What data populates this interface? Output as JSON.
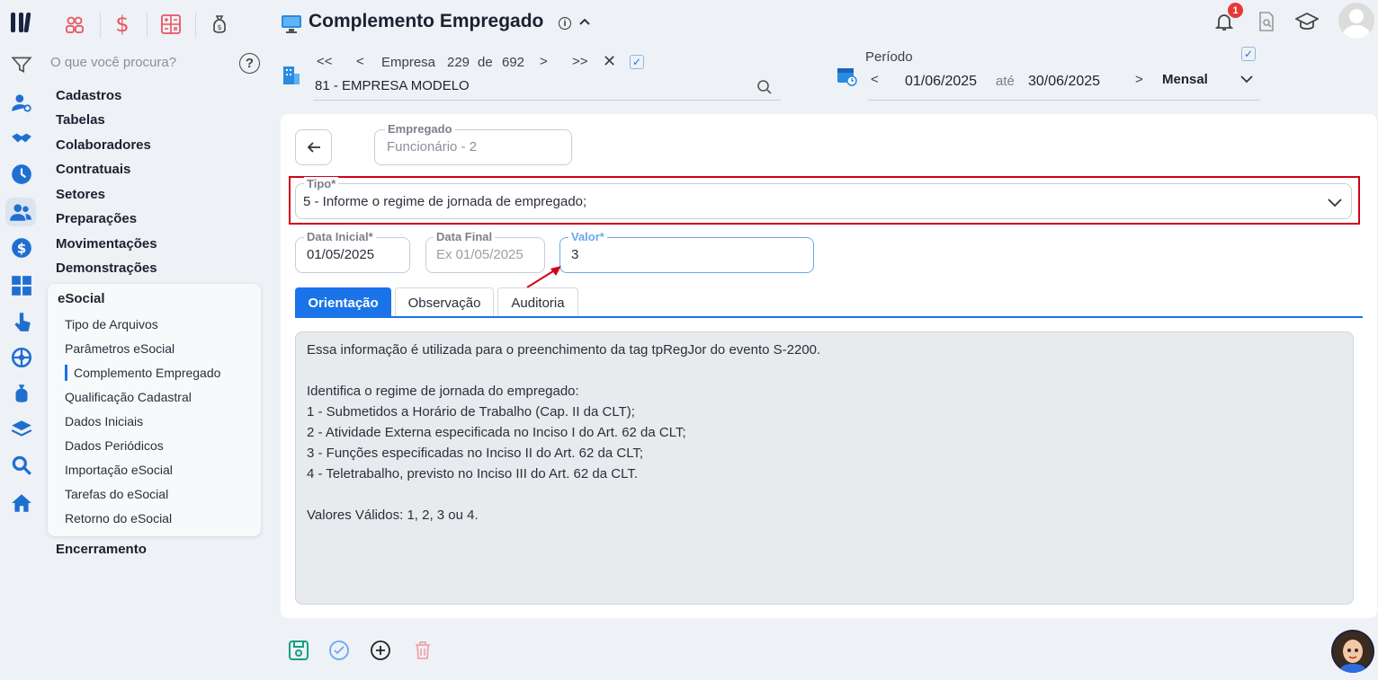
{
  "app": {
    "logo": "M-logo"
  },
  "modules": [
    {
      "icon": "people-icon"
    },
    {
      "icon": "dollar-icon"
    },
    {
      "icon": "calculator-icon"
    },
    {
      "icon": "money-bag-icon"
    }
  ],
  "search": {
    "placeholder": "O que você procura?"
  },
  "menu": {
    "items": [
      "Cadastros",
      "Tabelas",
      "Colaboradores",
      "Contratuais",
      "Setores",
      "Preparações",
      "Movimentações",
      "Demonstrações"
    ],
    "esocial": {
      "title": "eSocial",
      "items": [
        "Tipo de Arquivos",
        "Parâmetros eSocial",
        "Complemento Empregado",
        "Qualificação Cadastral",
        "Dados Iniciais",
        "Dados Periódicos",
        "Importação eSocial",
        "Tarefas do eSocial",
        "Retorno do eSocial"
      ],
      "active": "Complemento Empregado"
    },
    "last": "Encerramento"
  },
  "header": {
    "title": "Complemento Empregado",
    "notifications": "1"
  },
  "company_nav": {
    "first": "<<",
    "prev": "<",
    "label": "Empresa",
    "current": "229",
    "of": "de",
    "total": "692",
    "next": ">",
    "last": ">>",
    "selected": "81 - EMPRESA MODELO"
  },
  "period": {
    "label": "Período",
    "start": "01/06/2025",
    "until": "até",
    "end": "30/06/2025",
    "mode": "Mensal"
  },
  "form": {
    "employee": {
      "label": "Empregado",
      "value": "Funcionário - 2"
    },
    "tipo": {
      "label": "Tipo*",
      "value": "5 - Informe o regime de jornada de empregado;"
    },
    "data_inicial": {
      "label": "Data Inicial*",
      "value": "01/05/2025"
    },
    "data_final": {
      "label": "Data Final",
      "placeholder": "Ex 01/05/2025"
    },
    "valor": {
      "label": "Valor*",
      "value": "3"
    }
  },
  "tabs": [
    {
      "label": "Orientação",
      "active": true
    },
    {
      "label": "Observação",
      "active": false
    },
    {
      "label": "Auditoria",
      "active": false
    }
  ],
  "orientation": [
    "Essa informação é utilizada para o preenchimento da tag tpRegJor do evento S-2200.",
    "",
    "Identifica o regime de jornada do empregado:",
    "1 - Submetidos a Horário de Trabalho (Cap. II da CLT);",
    "2 - Atividade Externa especificada no Inciso I do Art. 62 da CLT;",
    "3 - Funções especificadas no Inciso II do Art. 62 da CLT;",
    "4 - Teletrabalho, previsto no Inciso III do Art. 62 da CLT.",
    "",
    "Valores Válidos: 1, 2, 3 ou 4."
  ],
  "colors": {
    "accent": "#1a73e8",
    "highlight": "#d0021b",
    "badge": "#e53935"
  }
}
